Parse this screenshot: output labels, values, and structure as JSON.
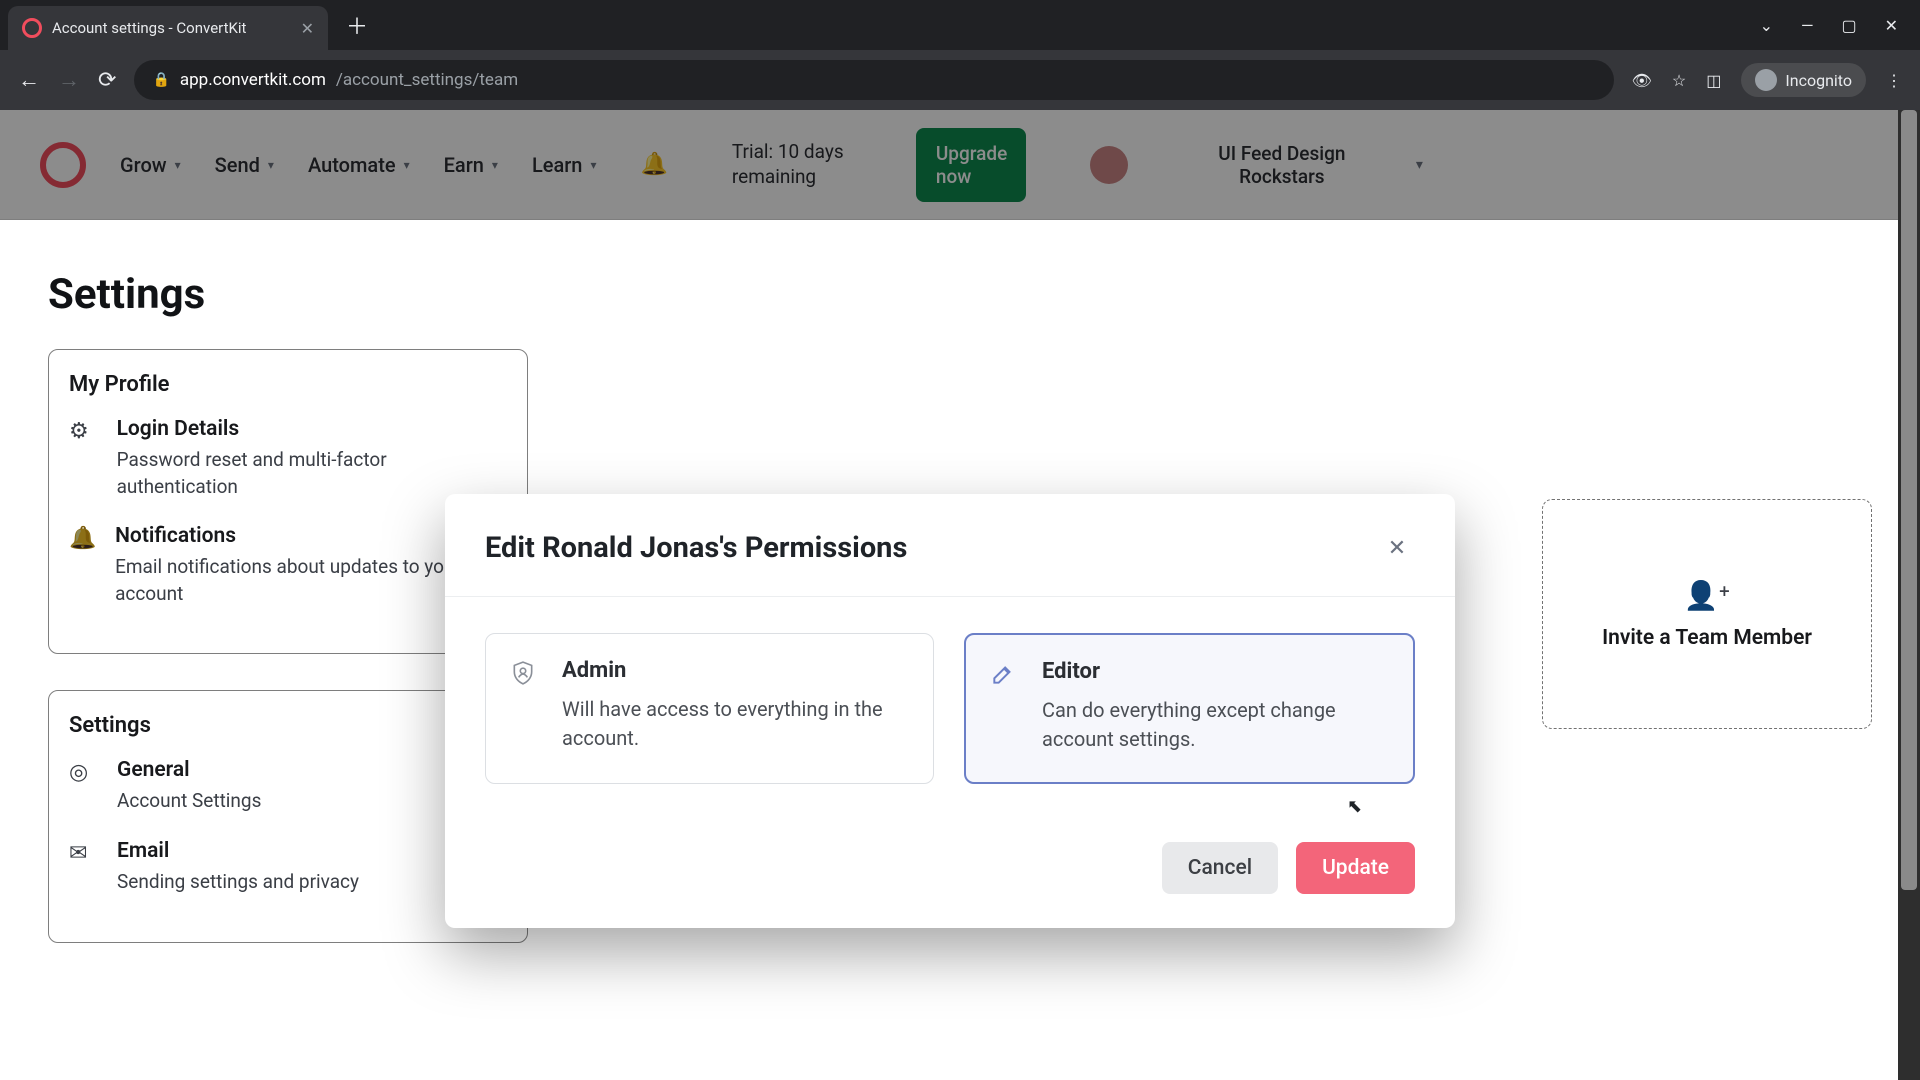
{
  "browser": {
    "tab_title": "Account settings - ConvertKit",
    "url_host": "app.convertkit.com",
    "url_path": "/account_settings/team",
    "incognito": "Incognito"
  },
  "header": {
    "nav": [
      "Grow",
      "Send",
      "Automate",
      "Earn",
      "Learn"
    ],
    "trial": "Trial: 10 days remaining",
    "upgrade": "Upgrade now",
    "workspace": "UI Feed Design Rockstars"
  },
  "page": {
    "title": "Settings"
  },
  "sidebar": {
    "group1": {
      "title": "My Profile",
      "items": [
        {
          "label": "Login Details",
          "desc": "Password reset and multi-factor authentication"
        },
        {
          "label": "Notifications",
          "desc": "Email notifications about updates to your account"
        }
      ]
    },
    "group2": {
      "title": "Settings",
      "items": [
        {
          "label": "General",
          "desc": "Account Settings"
        },
        {
          "label": "Email",
          "desc": "Sending settings and privacy"
        }
      ]
    }
  },
  "invite": {
    "label": "Invite a Team Member"
  },
  "modal": {
    "title": "Edit Ronald Jonas's Permissions",
    "roles": [
      {
        "name": "Admin",
        "desc": "Will have access to everything in the account.",
        "selected": false
      },
      {
        "name": "Editor",
        "desc": "Can do everything except change account settings.",
        "selected": true
      }
    ],
    "cancel": "Cancel",
    "update": "Update"
  }
}
